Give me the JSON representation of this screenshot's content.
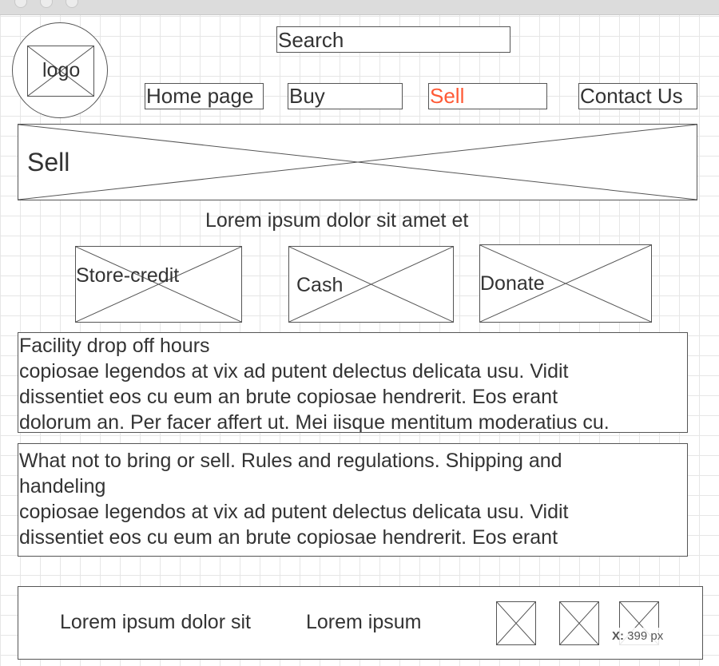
{
  "header": {
    "logo_label": "logo",
    "search_label": "Search"
  },
  "nav": {
    "items": [
      {
        "label": "Home page",
        "active": false
      },
      {
        "label": "Buy",
        "active": false
      },
      {
        "label": "Sell",
        "active": true
      },
      {
        "label": "Contact Us",
        "active": false
      }
    ],
    "active_color": "#ff5a36"
  },
  "banner": {
    "title": "Sell"
  },
  "intro": {
    "text": "Lorem ipsum dolor sit amet et"
  },
  "options": [
    {
      "label": "Store-credit"
    },
    {
      "label": "Cash"
    },
    {
      "label": "Donate"
    }
  ],
  "sections": [
    {
      "lines": [
        "Facility drop off hours",
        "copiosae legendos at vix ad putent delectus delicata usu. Vidit",
        "dissentiet eos cu eum an brute copiosae hendrerit. Eos erant",
        "dolorum an. Per facer affert ut. Mei iisque mentitum moderatius cu."
      ]
    },
    {
      "lines": [
        "What not to bring or sell. Rules and regulations. Shipping and",
        "handeling",
        "copiosae legendos at vix ad putent delectus delicata usu. Vidit",
        "dissentiet eos cu eum an brute copiosae hendrerit. Eos erant"
      ]
    }
  ],
  "footer": {
    "text_1": "Lorem ipsum dolor sit",
    "text_2": "Lorem ipsum"
  },
  "cursor_readout": {
    "axis": "X:",
    "value": "399 px"
  }
}
